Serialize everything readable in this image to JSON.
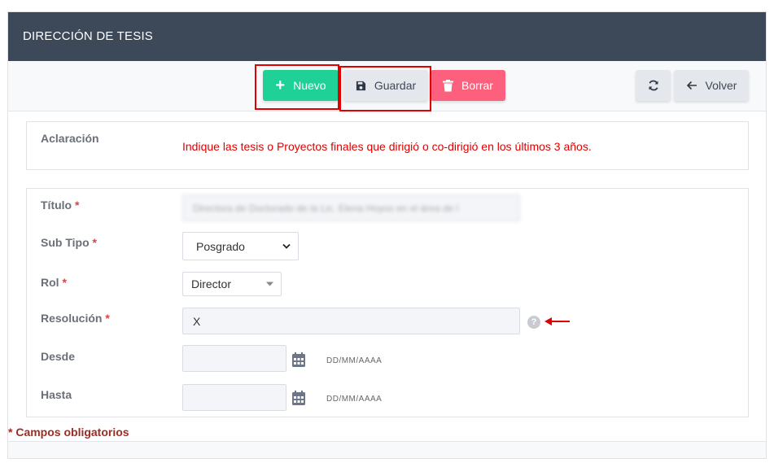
{
  "header": {
    "title": "DIRECCIÓN DE TESIS"
  },
  "toolbar": {
    "nuevo_label": "Nuevo",
    "guardar_label": "Guardar",
    "borrar_label": "Borrar",
    "volver_label": "Volver"
  },
  "aclaracion": {
    "label": "Aclaración",
    "text": "Indique las tesis o Proyectos finales que dirigió o co-dirigió en los últimos 3 años."
  },
  "form": {
    "titulo": {
      "label": "Título",
      "value": "Directora de Doctorado de la Lic. Elena Hoyos en el área de l"
    },
    "sub_tipo": {
      "label": "Sub Tipo",
      "value": "Posgrado"
    },
    "rol": {
      "label": "Rol",
      "value": "Director"
    },
    "resolucion": {
      "label": "Resolución",
      "value": "X"
    },
    "desde": {
      "label": "Desde",
      "value": "",
      "format": "DD/MM/AAAA"
    },
    "hasta": {
      "label": "Hasta",
      "value": "",
      "format": "DD/MM/AAAA"
    },
    "required_mark": "*"
  },
  "footer": {
    "required_note": "* Campos obligatorios"
  },
  "colors": {
    "header_bg": "#3d4858",
    "nuevo": "#1fd197",
    "borrar": "#fd607c",
    "neutral_button": "#e4e7eb",
    "highlight": "#e00000"
  }
}
